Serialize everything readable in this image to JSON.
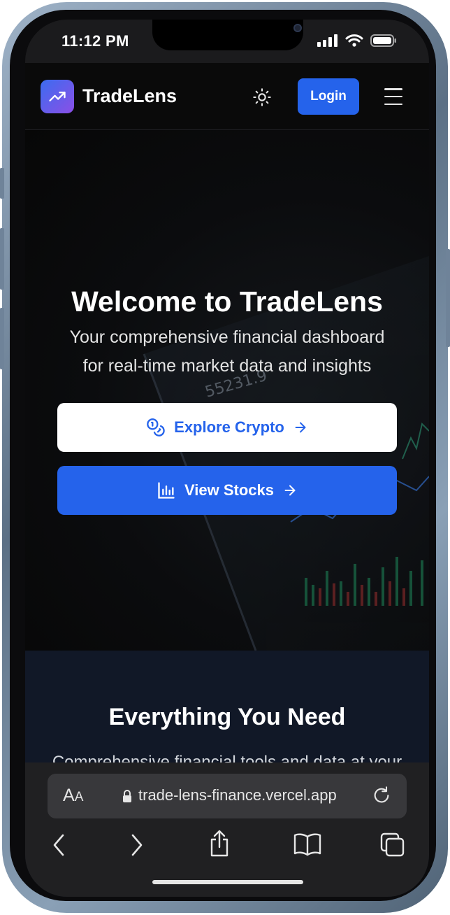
{
  "status_bar": {
    "time": "11:12 PM"
  },
  "header": {
    "brand": "TradeLens",
    "login_label": "Login"
  },
  "hero": {
    "title": "Welcome to TradeLens",
    "subtitle_line1": "Your comprehensive financial dashboard",
    "subtitle_line2": "for real-time market data and insights",
    "explore_crypto_label": "Explore Crypto",
    "view_stocks_label": "View Stocks",
    "background_ticker": "55231.9"
  },
  "features": {
    "title": "Everything You Need",
    "subtitle": "Comprehensive financial tools and data at your"
  },
  "browser": {
    "text_size_label_big": "A",
    "text_size_label_small": "A",
    "url": "trade-lens-finance.vercel.app"
  },
  "colors": {
    "accent": "#2563eb",
    "logo_gradient_start": "#3b6cf0",
    "logo_gradient_end": "#8b4fe6",
    "features_bg": "#111827"
  },
  "icons": [
    "trending-up-icon",
    "sun-icon",
    "menu-icon",
    "coins-icon",
    "arrow-right-icon",
    "bar-chart-icon",
    "lock-icon",
    "reload-icon",
    "back-icon",
    "forward-icon",
    "share-icon",
    "bookmarks-icon",
    "tabs-icon"
  ]
}
